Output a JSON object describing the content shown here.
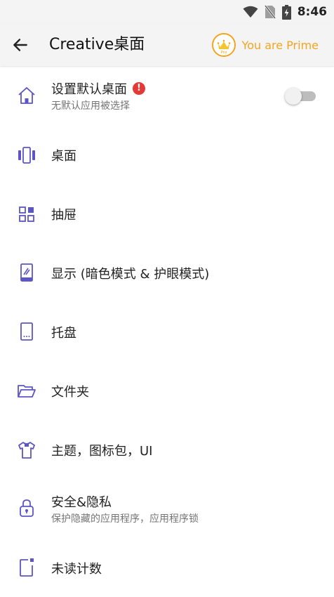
{
  "status_bar": {
    "time": "8:46",
    "icons": [
      "wifi-icon",
      "no-sim-icon",
      "battery-charging-icon"
    ]
  },
  "app_bar": {
    "title": "Creative桌面",
    "prime_label": "You are Prime",
    "badge_text": "Pro"
  },
  "colors": {
    "accent": "#5c55c5",
    "prime": "#f3a51f",
    "alert": "#e53935"
  },
  "settings": {
    "default_launcher": {
      "label": "设置默认桌面",
      "sub": "无默认应用被选择",
      "alert": "!",
      "toggle_on": false,
      "icon": "home-icon"
    },
    "items": [
      {
        "label": "桌面",
        "icon": "desktop-icon"
      },
      {
        "label": "抽屉",
        "icon": "drawer-icon"
      },
      {
        "label": "显示 (暗色模式 & 护眼模式)",
        "icon": "display-icon"
      },
      {
        "label": "托盘",
        "icon": "dock-icon"
      },
      {
        "label": "文件夹",
        "icon": "folder-icon"
      },
      {
        "label": "主题，图标包，UI",
        "icon": "theme-icon"
      },
      {
        "label": "安全&隐私",
        "sub": "保护隐藏的应用程序，应用程序锁",
        "icon": "lock-icon"
      },
      {
        "label": "未读计数",
        "icon": "badge-icon"
      }
    ]
  }
}
